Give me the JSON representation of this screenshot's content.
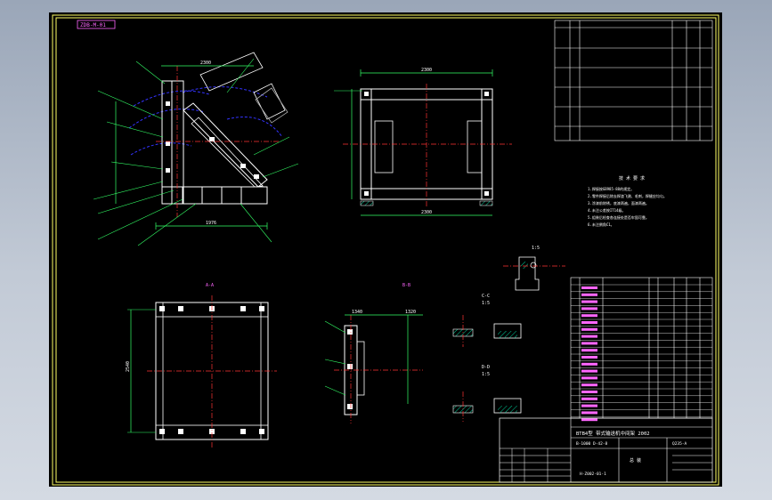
{
  "tag_label": "ZDB-M-01",
  "section_labels": {
    "section_a": "A-A",
    "section_b": "B-B",
    "section_c": "C-C",
    "section_d": "D-D"
  },
  "dimension_labels": {
    "left_top": "2300",
    "left_bottom": "1976",
    "front_top": "2300",
    "front_bottom": "2300",
    "plan_left": "2540",
    "side_left": "1340",
    "side_mid": "1320"
  },
  "scale_labels": {
    "s1": "1:5",
    "s2": "1:5",
    "s3": "1:5"
  },
  "notes": {
    "title": "技 术 要 求",
    "lines": [
      "1.焊接按GB985-88的规定。",
      "2.零件焊接后除去焊渣飞溅、毛刺，焊缝应均匀。",
      "3.涂漆前除锈，底漆两遍，面漆两遍。",
      "4.未注公差按IT14级。",
      "5.组装后检查各连接处是否牢固可靠。",
      "6.未注倒角C1。"
    ]
  },
  "title_block": {
    "main_title": "BTB4型 带式输送机中间架 2002",
    "drawing_no": "B-1000  D-42-8",
    "material": "Q235-A",
    "name": "总 装",
    "bottom_code": "H-Z002-01-1"
  },
  "colors": {
    "background_outer": "#b5bfcd",
    "sheet": "#000000",
    "border": "#ffff66",
    "outline": "#ffffff",
    "centerline": "#ff3333",
    "hidden": "#3333ff",
    "dimension": "#33ff66",
    "text": "#ff66ff",
    "hatch": "#00cc99"
  }
}
